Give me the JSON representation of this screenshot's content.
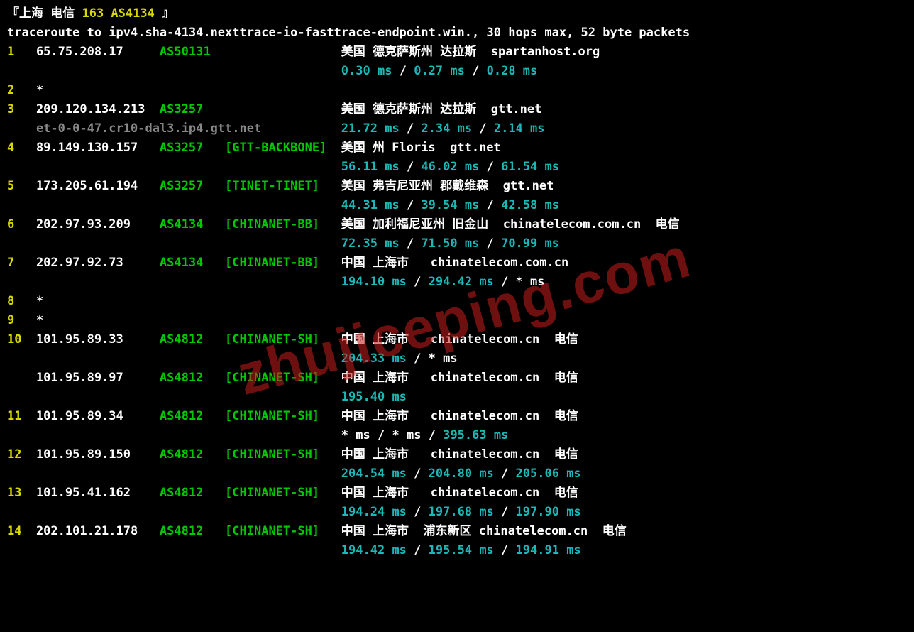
{
  "title": {
    "open": "『",
    "prefix": "上海 电信 ",
    "accent": "163 AS4134 ",
    "close": "』"
  },
  "cmd": "traceroute to ipv4.sha-4134.nexttrace-io-fasttrace-endpoint.win., 30 hops max, 52 byte packets",
  "watermark": "zhujiceping.com",
  "hops": [
    {
      "num": "1",
      "ip": "65.75.208.17",
      "asn": "AS50131",
      "tag": "",
      "loc": "美国 德克萨斯州 达拉斯  spartanhost.org",
      "rtt": [
        "0.30 ms",
        "0.27 ms",
        "0.28 ms"
      ]
    },
    {
      "num": "2",
      "ip": "*",
      "asn": "",
      "tag": "",
      "loc": "",
      "rtt": []
    },
    {
      "num": "3",
      "ip": "209.120.134.213",
      "asn": "AS3257",
      "tag": "",
      "loc": "美国 德克萨斯州 达拉斯  gtt.net",
      "rdns": "et-0-0-47.cr10-dal3.ip4.gtt.net",
      "rtt": [
        "21.72 ms",
        "2.34 ms",
        "2.14 ms"
      ]
    },
    {
      "num": "4",
      "ip": "89.149.130.157",
      "asn": "AS3257",
      "tag": "[GTT-BACKBONE]",
      "loc": "美国 州 Floris  gtt.net",
      "rtt": [
        "56.11 ms",
        "46.02 ms",
        "61.54 ms"
      ]
    },
    {
      "num": "5",
      "ip": "173.205.61.194",
      "asn": "AS3257",
      "tag": "[TINET-TINET]",
      "loc": "美国 弗吉尼亚州 郡戴维森  gtt.net",
      "rtt": [
        "44.31 ms",
        "39.54 ms",
        "42.58 ms"
      ]
    },
    {
      "num": "6",
      "ip": "202.97.93.209",
      "asn": "AS4134",
      "tag": "[CHINANET-BB]",
      "loc": "美国 加利福尼亚州 旧金山  chinatelecom.com.cn  电信",
      "rtt": [
        "72.35 ms",
        "71.50 ms",
        "70.99 ms"
      ]
    },
    {
      "num": "7",
      "ip": "202.97.92.73",
      "asn": "AS4134",
      "tag": "[CHINANET-BB]",
      "loc": "中国 上海市   chinatelecom.com.cn",
      "rtt": [
        "194.10 ms",
        "294.42 ms",
        "* ms"
      ]
    },
    {
      "num": "8",
      "ip": "*",
      "asn": "",
      "tag": "",
      "loc": "",
      "rtt": []
    },
    {
      "num": "9",
      "ip": "*",
      "asn": "",
      "tag": "",
      "loc": "",
      "rtt": []
    },
    {
      "num": "10",
      "ip": "101.95.89.33",
      "asn": "AS4812",
      "tag": "[CHINANET-SH]",
      "loc": "中国 上海市   chinatelecom.cn  电信",
      "rtt": [
        "204.33 ms",
        "* ms"
      ]
    },
    {
      "num": "",
      "ip": "101.95.89.97",
      "asn": "AS4812",
      "tag": "[CHINANET-SH]",
      "loc": "中国 上海市   chinatelecom.cn  电信",
      "rtt": [
        "195.40 ms"
      ]
    },
    {
      "num": "11",
      "ip": "101.95.89.34",
      "asn": "AS4812",
      "tag": "[CHINANET-SH]",
      "loc": "中国 上海市   chinatelecom.cn  电信",
      "rtt": [
        "* ms",
        "* ms",
        "395.63 ms"
      ]
    },
    {
      "num": "12",
      "ip": "101.95.89.150",
      "asn": "AS4812",
      "tag": "[CHINANET-SH]",
      "loc": "中国 上海市   chinatelecom.cn  电信",
      "rtt": [
        "204.54 ms",
        "204.80 ms",
        "205.06 ms"
      ]
    },
    {
      "num": "13",
      "ip": "101.95.41.162",
      "asn": "AS4812",
      "tag": "[CHINANET-SH]",
      "loc": "中国 上海市   chinatelecom.cn  电信",
      "rtt": [
        "194.24 ms",
        "197.68 ms",
        "197.90 ms"
      ]
    },
    {
      "num": "14",
      "ip": "202.101.21.178",
      "asn": "AS4812",
      "tag": "[CHINANET-SH]",
      "loc": "中国 上海市  浦东新区 chinatelecom.cn  电信",
      "rtt": [
        "194.42 ms",
        "195.54 ms",
        "194.91 ms"
      ]
    }
  ]
}
